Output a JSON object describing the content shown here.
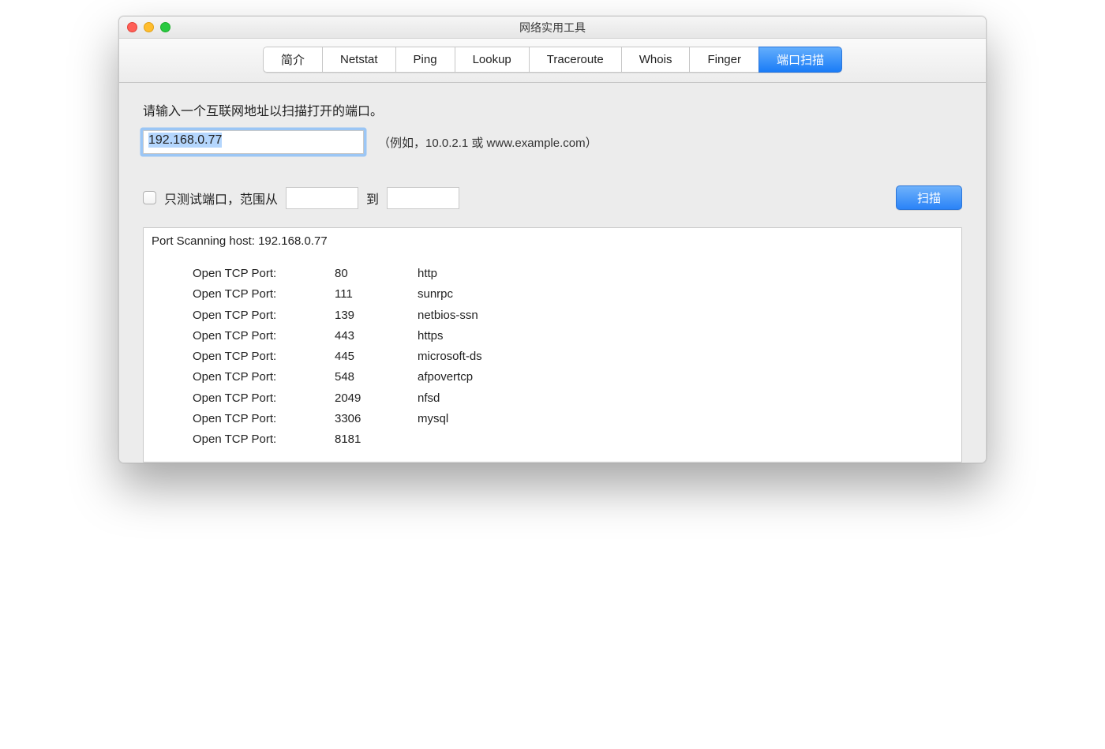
{
  "window": {
    "title": "网络实用工具"
  },
  "tabs": [
    {
      "label": "简介"
    },
    {
      "label": "Netstat"
    },
    {
      "label": "Ping"
    },
    {
      "label": "Lookup"
    },
    {
      "label": "Traceroute"
    },
    {
      "label": "Whois"
    },
    {
      "label": "Finger"
    },
    {
      "label": "端口扫描",
      "active": true
    }
  ],
  "prompt": "请输入一个互联网地址以扫描打开的端口。",
  "address_input": {
    "value": "192.168.0.77",
    "hint": "（例如，10.0.2.1 或 www.example.com）"
  },
  "range": {
    "label_prefix": "只测试端口，范围从",
    "label_to": "到",
    "from": "",
    "to": ""
  },
  "scan_button_label": "扫描",
  "results": {
    "header": "Port Scanning host: 192.168.0.77",
    "row_label": "Open TCP Port:",
    "rows": [
      {
        "port": "80",
        "service": "http"
      },
      {
        "port": "111",
        "service": "sunrpc"
      },
      {
        "port": "139",
        "service": "netbios-ssn"
      },
      {
        "port": "443",
        "service": "https"
      },
      {
        "port": "445",
        "service": "microsoft-ds"
      },
      {
        "port": "548",
        "service": "afpovertcp"
      },
      {
        "port": "2049",
        "service": "nfsd"
      },
      {
        "port": "3306",
        "service": "mysql"
      },
      {
        "port": "8181",
        "service": ""
      }
    ]
  }
}
